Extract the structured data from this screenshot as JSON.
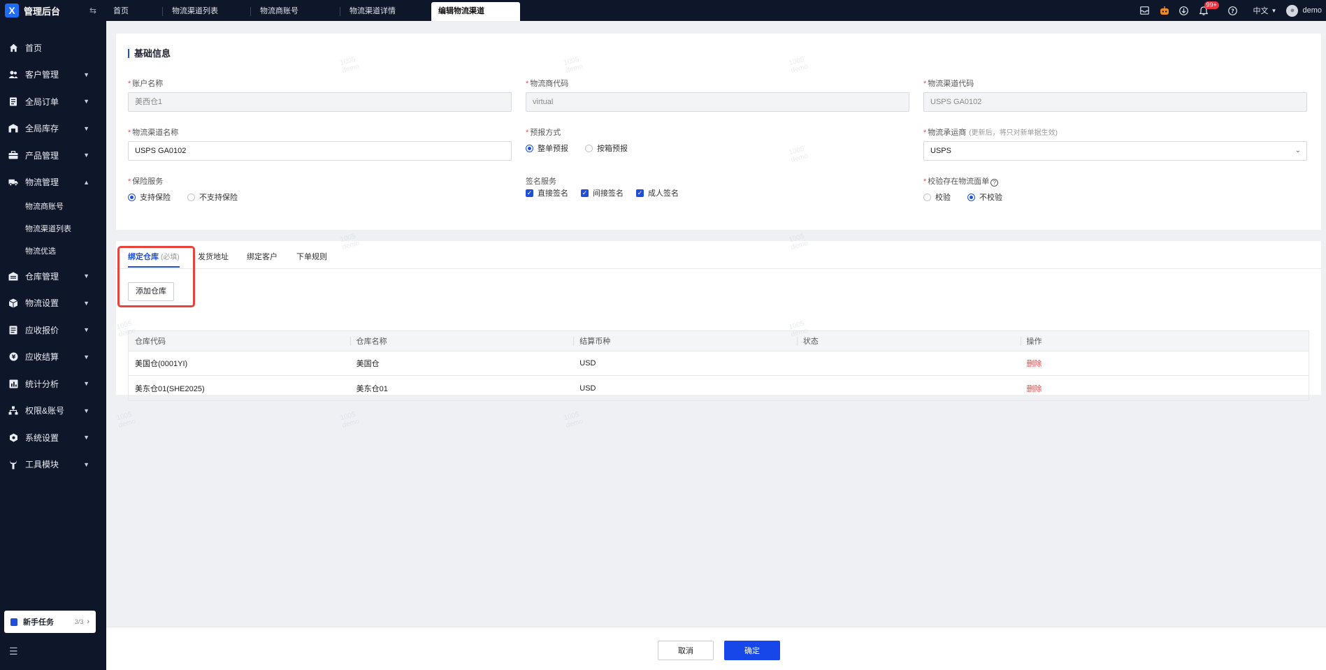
{
  "app": {
    "title": "管理后台",
    "logo": "X"
  },
  "sidebar": {
    "items": [
      {
        "label": "首页",
        "icon": "home-icon",
        "expandable": false
      },
      {
        "label": "客户管理",
        "icon": "users-icon",
        "expandable": true
      },
      {
        "label": "全局订单",
        "icon": "order-icon",
        "expandable": true
      },
      {
        "label": "全局库存",
        "icon": "warehouse-icon",
        "expandable": true
      },
      {
        "label": "产品管理",
        "icon": "product-icon",
        "expandable": true
      },
      {
        "label": "物流管理",
        "icon": "truck-icon",
        "expandable": true,
        "expanded": true,
        "children": [
          {
            "label": "物流商账号"
          },
          {
            "label": "物流渠道列表"
          },
          {
            "label": "物流优选"
          }
        ]
      },
      {
        "label": "仓库管理",
        "icon": "storehouse-icon",
        "expandable": true
      },
      {
        "label": "物流设置",
        "icon": "box-settings-icon",
        "expandable": true
      },
      {
        "label": "应收报价",
        "icon": "quote-icon",
        "expandable": true
      },
      {
        "label": "应收结算",
        "icon": "coin-icon",
        "expandable": true
      },
      {
        "label": "统计分析",
        "icon": "chart-icon",
        "expandable": true
      },
      {
        "label": "权限&账号",
        "icon": "hierarchy-icon",
        "expandable": true
      },
      {
        "label": "系统设置",
        "icon": "gear-icon",
        "expandable": true
      },
      {
        "label": "工具模块",
        "icon": "wrench-icon",
        "expandable": true
      }
    ],
    "task": {
      "label": "新手任务",
      "count": "3/3"
    }
  },
  "tabs": [
    {
      "label": "首页",
      "active": false
    },
    {
      "label": "物流渠道列表",
      "active": false
    },
    {
      "label": "物流商账号",
      "active": false
    },
    {
      "label": "物流渠道详情",
      "active": false
    },
    {
      "label": "编辑物流渠道",
      "active": true
    }
  ],
  "topbar": {
    "notification_badge": "99+",
    "language": "中文",
    "username": "demo"
  },
  "basic": {
    "title": "基础信息",
    "account_name": {
      "label": "账户名称",
      "value": "美西仓1"
    },
    "carrier_code": {
      "label": "物流商代码",
      "value": "virtual"
    },
    "channel_code": {
      "label": "物流渠道代码",
      "value": "USPS GA0102"
    },
    "channel_name": {
      "label": "物流渠道名称",
      "value": "USPS GA0102"
    },
    "forecast": {
      "label": "预报方式",
      "options": [
        "整单预报",
        "按箱预报"
      ],
      "selected": 0
    },
    "carrier": {
      "label": "物流承运商",
      "hint": "(更新后，将只对新单据生效)",
      "value": "USPS"
    },
    "insurance": {
      "label": "保险服务",
      "options": [
        "支持保险",
        "不支持保险"
      ],
      "selected": 0
    },
    "signature": {
      "label": "签名服务",
      "options": [
        "直接签名",
        "间接签名",
        "成人签名"
      ]
    },
    "verify": {
      "label": "校验存在物流面单",
      "options": [
        "校验",
        "不校验"
      ],
      "selected": 1
    }
  },
  "bind": {
    "tabs": [
      {
        "label": "绑定仓库",
        "note": "(必填)"
      },
      {
        "label": "发货地址"
      },
      {
        "label": "绑定客户"
      },
      {
        "label": "下单规则"
      }
    ],
    "add_button": "添加仓库",
    "columns": [
      "仓库代码",
      "仓库名称",
      "结算币种",
      "状态",
      "操作"
    ],
    "rows": [
      {
        "code": "美国仓(0001YI)",
        "name": "美国仓",
        "currency": "USD",
        "status": "",
        "action": "删除"
      },
      {
        "code": "美东仓01(SHE2025)",
        "name": "美东仓01",
        "currency": "USD",
        "status": "",
        "action": "删除"
      }
    ]
  },
  "watermark": {
    "line1": "1005",
    "line2": "demo"
  },
  "footer": {
    "cancel": "取消",
    "confirm": "确定"
  },
  "colors": {
    "primary": "#1e4fd6",
    "sidebar_bg": "#0e1629",
    "danger": "#e34d4d",
    "highlight": "#e6433a"
  }
}
